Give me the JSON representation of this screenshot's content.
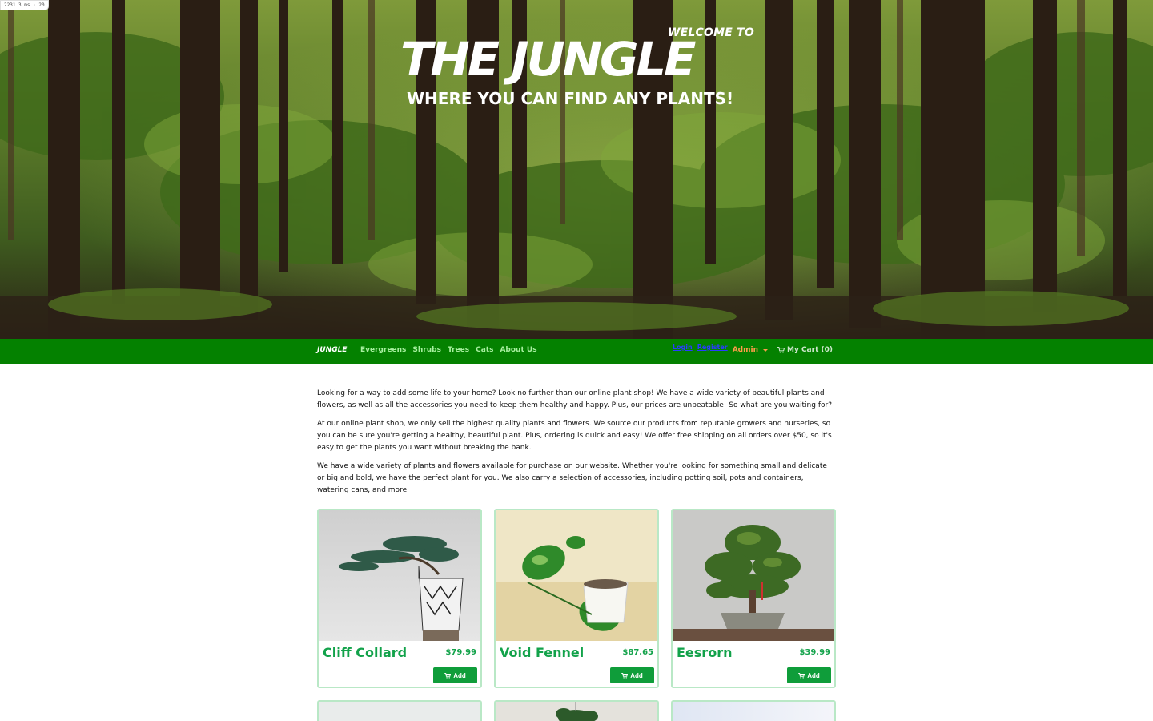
{
  "dimension_badge": "2231.3 ms · 20",
  "hero": {
    "welcome": "WELCOME TO",
    "title": "THE JUNGLE",
    "tagline": "WHERE YOU CAN FIND ANY PLANTS!"
  },
  "nav": {
    "brand": "JUNGLE",
    "links": [
      "Evergreens",
      "Shrubs",
      "Trees",
      "Cats",
      "About Us"
    ],
    "login": "Login",
    "register": "Register",
    "admin": "Admin",
    "cart": "My Cart (0)"
  },
  "intro": {
    "paragraphs": [
      "Looking for a way to add some life to your home? Look no further than our online plant shop! We have a wide variety of beautiful plants and flowers, as well as all the accessories you need to keep them healthy and happy. Plus, our prices are unbeatable! So what are you waiting for?",
      "At our online plant shop, we only sell the highest quality plants and flowers. We source our products from reputable growers and nurseries, so you can be sure you're getting a healthy, beautiful plant. Plus, ordering is quick and easy! We offer free shipping on all orders over $50, so it's easy to get the plants you want without breaking the bank.",
      "We have a wide variety of plants and flowers available for purchase on our website. Whether you're looking for something small and delicate or big and bold, we have the perfect plant for you. We also carry a selection of accessories, including potting soil, pots and containers, watering cans, and more."
    ]
  },
  "products": [
    {
      "name": "Cliff Collard",
      "price": "$79.99",
      "add_label": "Add"
    },
    {
      "name": "Void Fennel",
      "price": "$87.65",
      "add_label": "Add"
    },
    {
      "name": "Eesrorn",
      "price": "$39.99",
      "add_label": "Add"
    }
  ],
  "colors": {
    "nav_bg": "#048100",
    "accent": "#12a24a",
    "button": "#0f9d3a",
    "admin": "#ff9c4a"
  },
  "icons": [
    "cart-icon",
    "caret-down-icon"
  ]
}
